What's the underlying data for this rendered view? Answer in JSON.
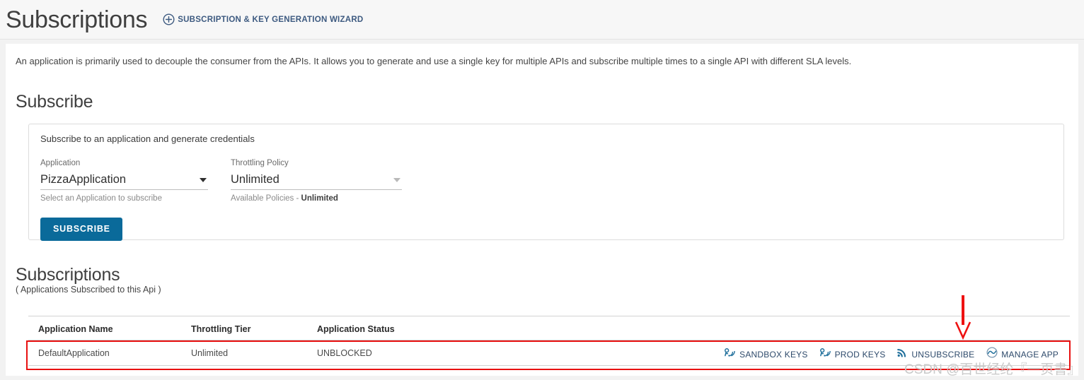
{
  "header": {
    "title": "Subscriptions",
    "wizard_label": "SUBSCRIPTION & KEY GENERATION WIZARD",
    "wizard_icon": "plus-circle-icon"
  },
  "intro": {
    "text": "An application is primarily used to decouple the consumer from the APIs. It allows you to generate and use a single key for multiple APIs and subscribe multiple times to a single API with different SLA levels."
  },
  "subscribe_section": {
    "heading": "Subscribe",
    "card_caption": "Subscribe to an application and generate credentials",
    "application_field": {
      "label": "Application",
      "value": "PizzaApplication",
      "hint": "Select an Application to subscribe",
      "caret_icon": "chevron-down-icon"
    },
    "policy_field": {
      "label": "Throttling Policy",
      "value": "Unlimited",
      "hint_prefix": "Available Policies - ",
      "hint_value": "Unlimited",
      "caret_icon": "chevron-down-icon"
    },
    "submit_label": "SUBSCRIBE",
    "submit_color": "#0a6a9a"
  },
  "subscriptions_section": {
    "heading": "Subscriptions",
    "caption": "( Applications Subscribed to this Api )",
    "columns": [
      "Application Name",
      "Throttling Tier",
      "Application Status"
    ],
    "rows": [
      {
        "application_name": "DefaultApplication",
        "throttling_tier": "Unlimited",
        "application_status": "UNBLOCKED",
        "actions": [
          {
            "label": "SANDBOX KEYS",
            "icon": "key-wireless-icon"
          },
          {
            "label": "PROD KEYS",
            "icon": "key-wireless-icon"
          },
          {
            "label": "UNSUBSCRIBE",
            "icon": "rss-signal-icon"
          },
          {
            "label": "MANAGE APP",
            "icon": "circle-wave-icon"
          }
        ]
      }
    ]
  },
  "annotations": {
    "highlight_color": "#e81010",
    "arrow_icon": "down-arrow-icon"
  },
  "watermark": {
    "text": "CSDN @百世经纶『一页書』"
  }
}
